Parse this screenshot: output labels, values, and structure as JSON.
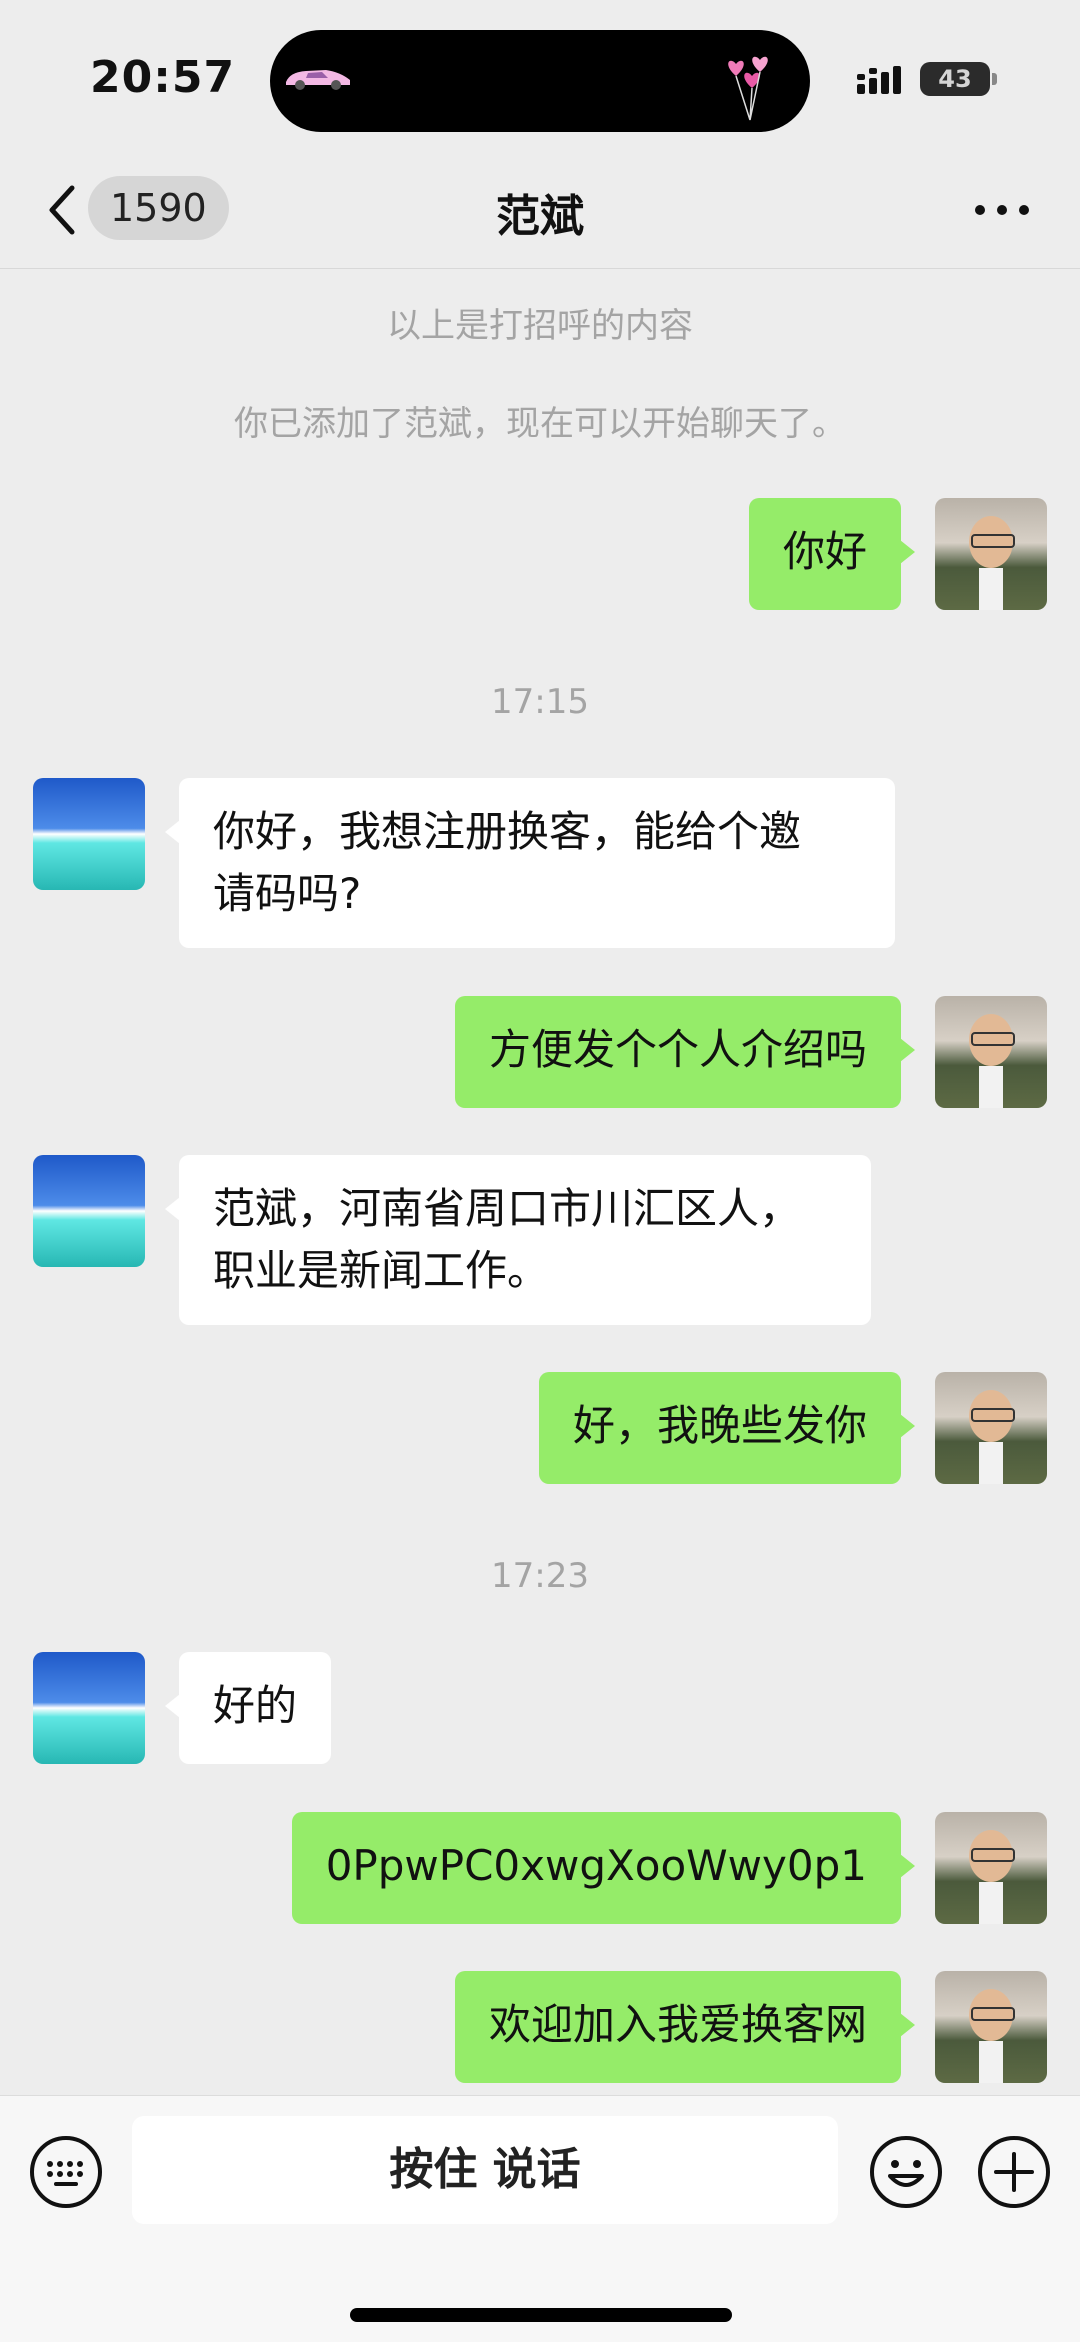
{
  "status_bar": {
    "time": "20:57",
    "battery": "43"
  },
  "nav": {
    "back_count": "1590",
    "title": "范斌"
  },
  "system_notes": [
    "以上是打招呼的内容",
    "你已添加了范斌，现在可以开始聊天了。"
  ],
  "timestamps": [
    "17:15",
    "17:23"
  ],
  "messages": [
    {
      "from": "me",
      "text": "你好"
    },
    {
      "from": "them",
      "line1": "你好，我想注册换客，能给个邀",
      "line2": "请码吗?"
    },
    {
      "from": "me",
      "text": "方便发个个人介绍吗"
    },
    {
      "from": "them",
      "line1": "范斌，河南省周口市川汇区人，",
      "line2": "职业是新闻工作。"
    },
    {
      "from": "me",
      "text": "好，我晚些发你"
    },
    {
      "from": "them",
      "text": "好的"
    },
    {
      "from": "me",
      "text": "0PpwPC0xwgXooWwy0p1"
    },
    {
      "from": "me",
      "text": "欢迎加入我爱换客网"
    }
  ],
  "input_bar": {
    "voice_label": "按住 说话"
  },
  "colors": {
    "outgoing_bubble": "#95ec69",
    "incoming_bubble": "#ffffff",
    "background": "#ededed"
  }
}
